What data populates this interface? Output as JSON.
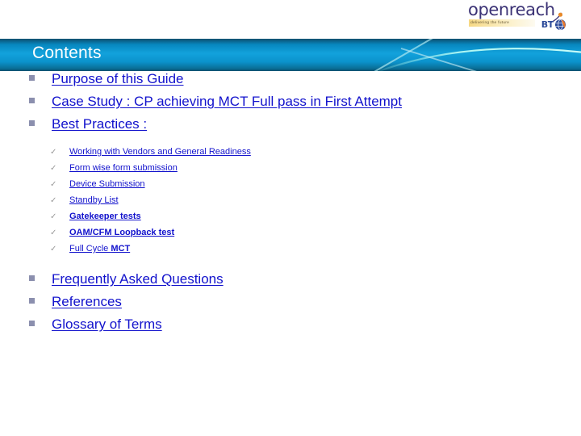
{
  "logo": {
    "brand": "openreach",
    "tagline": "delivering the future",
    "parent_brand": "BT",
    "swoosh_icon": "openreach-swoosh-icon",
    "globe_icon": "bt-globe-icon"
  },
  "header": {
    "title": "Contents"
  },
  "slide": {
    "items": [
      {
        "level": 1,
        "marker": "square-bullet",
        "label": "Purpose of this Guide",
        "bold": false
      },
      {
        "level": 1,
        "marker": "square-bullet",
        "label": "Case Study : CP achieving MCT Full pass in First Attempt",
        "bold": false
      },
      {
        "level": 1,
        "marker": "square-bullet",
        "label": "Best Practices :",
        "bold": false
      },
      {
        "level": 2,
        "marker": "check-bullet",
        "marker_glyph": "✓",
        "label": "Working with Vendors and General Readiness",
        "bold": false
      },
      {
        "level": 2,
        "marker": "check-bullet",
        "marker_glyph": "✓",
        "label": "Form wise form submission",
        "bold": false
      },
      {
        "level": 2,
        "marker": "check-bullet",
        "marker_glyph": "✓",
        "label": "Device Submission",
        "bold": false
      },
      {
        "level": 2,
        "marker": "check-bullet",
        "marker_glyph": "✓",
        "label": "Standby List",
        "bold": false
      },
      {
        "level": 2,
        "marker": "check-bullet",
        "marker_glyph": "✓",
        "label": "Gatekeeper tests",
        "bold": true
      },
      {
        "level": 2,
        "marker": "check-bullet",
        "marker_glyph": "✓",
        "label": "OAM/CFM Loopback test",
        "bold": true
      },
      {
        "level": 2,
        "marker": "check-bullet",
        "marker_glyph": "✓",
        "label_plain": "Full Cycle ",
        "label_bold": "MCT",
        "label": "Full Cycle MCT",
        "bold": false,
        "mixed": true
      },
      {
        "level": 1,
        "marker": "square-bullet",
        "label": "Frequently Asked Questions",
        "bold": false
      },
      {
        "level": 1,
        "marker": "square-bullet",
        "label": "References",
        "bold": false
      },
      {
        "level": 1,
        "marker": "square-bullet",
        "label": "Glossary of Terms",
        "bold": false
      }
    ]
  },
  "colors": {
    "link": "#1111cc",
    "band_primary": "#12a2dc",
    "band_dark": "#06506f",
    "bullet_square": "#8b8fae",
    "bullet_check": "#9a9a9a",
    "brand_purple": "#3b3275",
    "bt_blue": "#2d4b9a",
    "strip_yellow": "#f6d884"
  }
}
